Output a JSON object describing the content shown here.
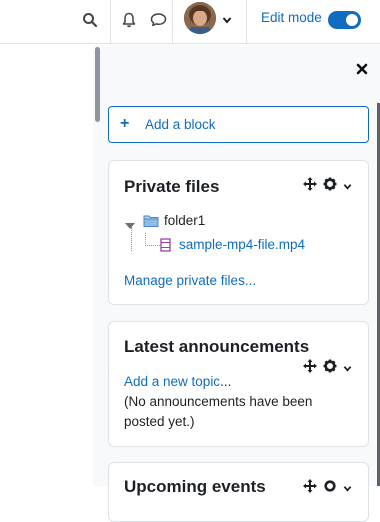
{
  "header": {
    "edit_mode_label": "Edit mode",
    "edit_mode_on": true,
    "accent_color": "#0f6cbf"
  },
  "add_block": {
    "label": "Add a block"
  },
  "private_files": {
    "title": "Private files",
    "folder_name": "folder1",
    "file_name": "sample-mp4-file.mp4",
    "manage_link": "Manage private files..."
  },
  "announcements": {
    "title": "Latest announcements",
    "add_topic_link": "Add a new topic",
    "ellipsis": "...",
    "empty_text": "(No announcements have been posted yet.)"
  },
  "upcoming": {
    "title": "Upcoming events"
  },
  "icons": [
    "search-icon",
    "bell-icon",
    "chat-icon",
    "chevron-down-icon",
    "close-icon",
    "plus-icon",
    "move-icon",
    "gear-icon",
    "folder-icon",
    "file-icon",
    "triangle-down-icon"
  ]
}
